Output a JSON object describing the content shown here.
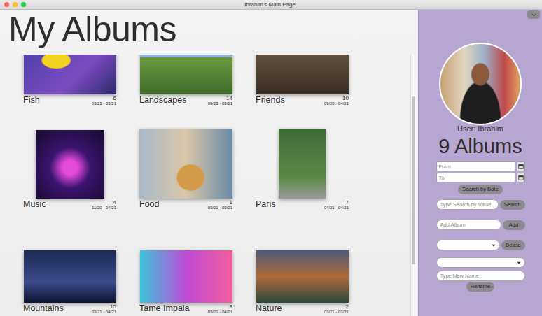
{
  "window": {
    "title": "Ibrahim's Main Page"
  },
  "heading": "My Albums",
  "albums": [
    {
      "name": "Fish",
      "count": "6",
      "dates": "03/21 - 03/21"
    },
    {
      "name": "Landscapes",
      "count": "14",
      "dates": "09/23 - 03/21"
    },
    {
      "name": "Friends",
      "count": "10",
      "dates": "09/20 - 04/21"
    },
    {
      "name": "Music",
      "count": "4",
      "dates": "11/20 - 04/21"
    },
    {
      "name": "Food",
      "count": "1",
      "dates": "03/21 - 03/21"
    },
    {
      "name": "Paris",
      "count": "7",
      "dates": "04/21 - 04/21"
    },
    {
      "name": "Mountains",
      "count": "15",
      "dates": "03/21 - 04/21"
    },
    {
      "name": "Tame Impala",
      "count": "8",
      "dates": "03/21 - 04/21"
    },
    {
      "name": "Nature",
      "count": "2",
      "dates": "03/21 - 03/21"
    }
  ],
  "profile": {
    "user_label": "User: Ibrahim",
    "album_count": "9 Albums"
  },
  "date_search": {
    "from_placeholder": "From",
    "to_placeholder": "To",
    "button": "Search by Date"
  },
  "value_search": {
    "placeholder": "Type Search by Value",
    "button": "Search"
  },
  "add_album": {
    "placeholder": "Add Album",
    "button": "Add"
  },
  "delete_album": {
    "button": "Delete"
  },
  "rename_album": {
    "placeholder": "Type New Name",
    "button": "Rename"
  }
}
